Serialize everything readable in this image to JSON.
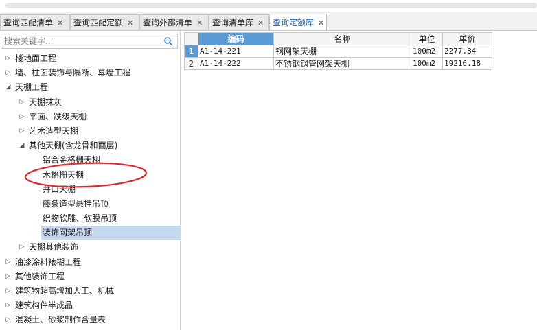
{
  "tabs": [
    {
      "label": "查询匹配清单",
      "active": false
    },
    {
      "label": "查询匹配定额",
      "active": false
    },
    {
      "label": "查询外部清单",
      "active": false
    },
    {
      "label": "查询清单库",
      "active": false
    },
    {
      "label": "查询定额库",
      "active": true
    }
  ],
  "close_glyph": "✕",
  "search": {
    "placeholder": "搜索关键字...",
    "value": "",
    "icon": "search-icon"
  },
  "tree": [
    {
      "label": "楼地面工程",
      "toggle": "▷"
    },
    {
      "label": "墙、柱面装饰与隔断、幕墙工程",
      "toggle": "▷"
    },
    {
      "label": "天棚工程",
      "toggle": "◢"
    },
    {
      "label": "天棚抹灰",
      "toggle": "▷"
    },
    {
      "label": "平面、跌级天棚",
      "toggle": "▷"
    },
    {
      "label": "艺术造型天棚",
      "toggle": "▷"
    },
    {
      "label": "其他天棚(含龙骨和面层)",
      "toggle": "◢"
    },
    {
      "label": "铝合金格栅天棚",
      "toggle": ""
    },
    {
      "label": "木格栅天棚",
      "toggle": ""
    },
    {
      "label": "井口天棚",
      "toggle": ""
    },
    {
      "label": "藤条造型悬挂吊顶",
      "toggle": ""
    },
    {
      "label": "织物软雕、软膜吊顶",
      "toggle": ""
    },
    {
      "label": "装饰网架吊顶",
      "toggle": ""
    },
    {
      "label": "天棚其他装饰",
      "toggle": "▷"
    },
    {
      "label": "油漆涂料裱糊工程",
      "toggle": "▷"
    },
    {
      "label": "其他装饰工程",
      "toggle": "▷"
    },
    {
      "label": "建筑物超高增加人工、机械",
      "toggle": "▷"
    },
    {
      "label": "建筑构件半成品",
      "toggle": "▷"
    },
    {
      "label": "混凝土、砂浆制作含量表",
      "toggle": "▷"
    }
  ],
  "table": {
    "headers": [
      "编码",
      "名称",
      "单位",
      "单价"
    ],
    "rows": [
      {
        "num": "1",
        "code": "A1-14-221",
        "name": "钢网架天棚",
        "unit": "100m2",
        "price": "2277.84"
      },
      {
        "num": "2",
        "code": "A1-14-222",
        "name": "不锈钢钢管网架天棚",
        "unit": "100m2",
        "price": "19216.18"
      }
    ]
  },
  "colors": {
    "accent": "#5a9bd5",
    "selection": "#c7d9ee",
    "annotation": "#e0282a",
    "active_tab_text": "#1a5fb4"
  }
}
